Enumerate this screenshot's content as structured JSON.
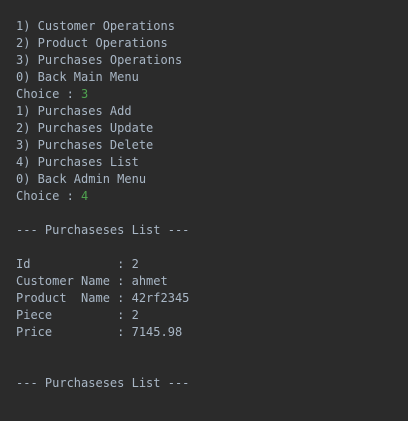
{
  "colors": {
    "background": "#2b2b2b",
    "text": "#a9b7c6",
    "user_input": "#4fa34f"
  },
  "main_menu": {
    "items": [
      "1) Customer Operations",
      "2) Product Operations",
      "3) Purchases Operations",
      "0) Back Main Menu"
    ],
    "choice_label": "Choice : ",
    "choice_value": "3"
  },
  "purchase_menu": {
    "items": [
      "1) Purchases Add",
      "2) Purchases Update",
      "3) Purchases Delete",
      "4) Purchases List",
      "0) Back Admin Menu"
    ],
    "choice_label": "Choice : ",
    "choice_value": "4"
  },
  "list_header": "--- Purchaseses List ---",
  "record": {
    "id": "Id            : 2",
    "customer_name": "Customer Name : ahmet",
    "product_name": "Product  Name : 42rf2345",
    "piece": "Piece         : 2",
    "price": "Price         : 7145.98"
  },
  "list_footer": "--- Purchaseses List ---"
}
